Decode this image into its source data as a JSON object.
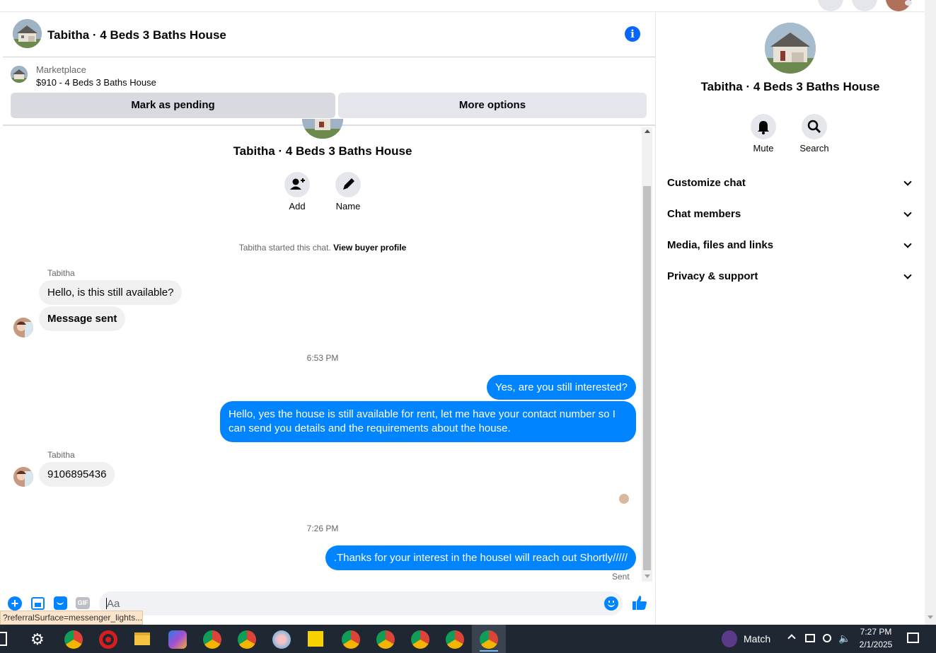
{
  "header": {
    "title": "Tabitha · 4 Beds 3 Baths House",
    "info_icon": "info-icon"
  },
  "marketplace": {
    "label": "Marketplace",
    "item": "$910 - 4 Beds 3 Baths House",
    "mark_pending": "Mark as pending",
    "more_options": "More options"
  },
  "conversation": {
    "title": "Tabitha · 4 Beds 3 Baths House",
    "add_label": "Add",
    "name_label": "Name",
    "started_text": "Tabitha started this chat.",
    "view_buyer": "View buyer profile",
    "messages": [
      {
        "sender": "Tabitha",
        "text": "Hello, is this still available?"
      },
      {
        "text": "Message sent"
      },
      {
        "timestamp": "6:53 PM"
      },
      {
        "out": true,
        "text": "Yes, are you still interested?"
      },
      {
        "out": true,
        "text": "Hello, yes the house is still available for rent, let me have your contact number so I can send you details and the requirements about the house."
      },
      {
        "sender": "Tabitha",
        "text": "9106895436"
      },
      {
        "timestamp": "7:26 PM"
      },
      {
        "out": true,
        "text": ".Thanks for your interest in the houseI will reach out Shortly/////"
      }
    ],
    "status": "Sent"
  },
  "composer": {
    "placeholder": "Aa",
    "gif_label": "GIF"
  },
  "right_panel": {
    "title": "Tabitha · 4 Beds 3 Baths House",
    "mute_label": "Mute",
    "search_label": "Search",
    "sections": [
      "Customize chat",
      "Chat members",
      "Media, files and links",
      "Privacy & support"
    ]
  },
  "status_bar": {
    "url": "?referralSurface=messenger_lights..."
  },
  "taskbar": {
    "match_label": "Match",
    "time": "7:27 PM",
    "date": "2/1/2025"
  },
  "colors": {
    "accent": "#0084ff",
    "bubble_in": "#f0f0f0",
    "taskbar": "#1f2733"
  }
}
